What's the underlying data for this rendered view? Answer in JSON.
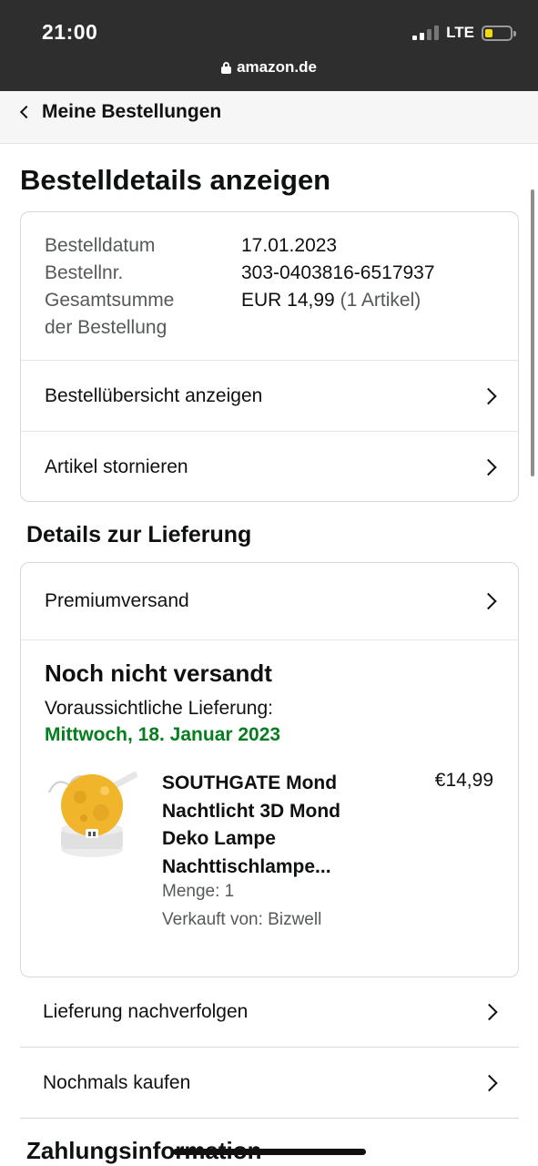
{
  "status": {
    "time": "21:00",
    "network": "LTE",
    "url": "amazon.de"
  },
  "nav": {
    "back_label": "Meine Bestellungen"
  },
  "page": {
    "title": "Bestelldetails anzeigen"
  },
  "order": {
    "date_label": "Bestelldatum",
    "date_value": "17.01.2023",
    "number_label": "Bestellnr.",
    "number_value": "303-0403816-6517937",
    "total_label_line1": "Gesamtsumme",
    "total_label_line2": "der Bestellung",
    "total_value": "EUR 14,99",
    "total_items": "(1 Artikel)",
    "links": [
      {
        "label": "Bestellübersicht anzeigen"
      },
      {
        "label": "Artikel stornieren"
      }
    ]
  },
  "delivery": {
    "section_title": "Details zur Lieferung",
    "shipping_method": "Premiumversand",
    "status": "Noch nicht versandt",
    "estimate_label": "Voraussichtliche Lieferung:",
    "estimate_date": "Mittwoch, 18. Januar 2023",
    "product": {
      "title_line1": "SOUTHGATE Mond",
      "title_line2": "Nachtlicht 3D Mond",
      "title_line3": "Deko Lampe",
      "title_line4": "Nachttischlampe...",
      "price": "€14,99",
      "quantity": "Menge: 1",
      "seller": "Verkauft von: Bizwell",
      "image_icon": "moon-lamp-product-image"
    }
  },
  "actions": [
    {
      "label": "Lieferung nachverfolgen"
    },
    {
      "label": "Nochmals kaufen"
    }
  ],
  "payment": {
    "section_title": "Zahlungsinformation"
  },
  "colors": {
    "statusbar": "#2e2e2e",
    "delivery_green": "#067d1f",
    "muted_text": "#565959",
    "border": "#d5d9d9",
    "battery": "#f5d90a"
  }
}
